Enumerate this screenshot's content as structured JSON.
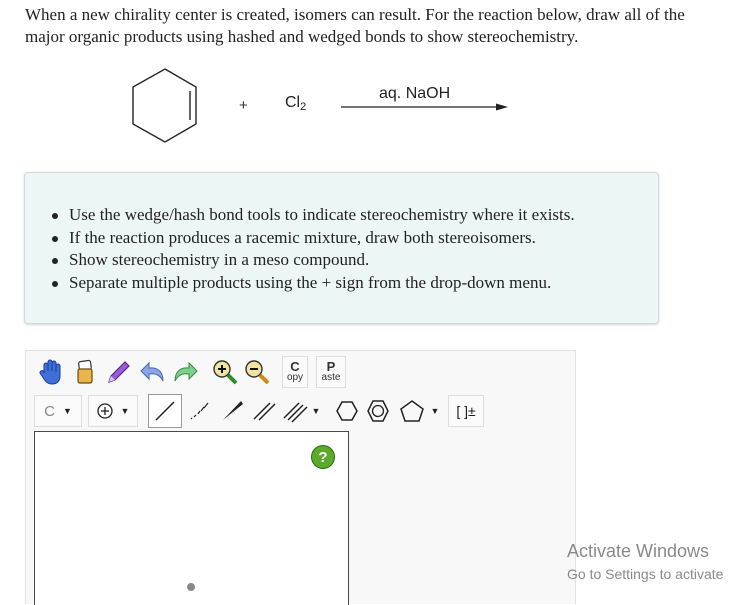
{
  "question": {
    "text": "When a new chirality center is created, isomers can result. For the reaction below, draw all of the major organic products using hashed and wedged bonds to show stereochemistry."
  },
  "reaction": {
    "plus": "+",
    "reagent_formula": "Cl",
    "reagent_subscript": "2",
    "conditions": "aq. NaOH"
  },
  "instructions": {
    "items": [
      "Use the wedge/hash bond tools to indicate stereochemistry where it exists.",
      "If the reaction produces a racemic mixture, draw both stereoisomers.",
      "Show stereochemistry in a meso compound.",
      "Separate multiple products using the + sign from the drop-down menu."
    ]
  },
  "editor": {
    "toolbar": {
      "copy_top": "C",
      "copy_bottom": "opy",
      "paste_top": "P",
      "paste_bottom": "aste",
      "atom_label": "C",
      "charge_label": "[ ]±",
      "icons": [
        "hand-icon",
        "eraser-icon",
        "pen-icon",
        "undo-icon",
        "redo-icon",
        "zoom-in-icon",
        "zoom-out-icon"
      ]
    },
    "help_label": "?"
  },
  "watermark": {
    "title": "Activate Windows",
    "subtitle": "Go to Settings to activate"
  }
}
